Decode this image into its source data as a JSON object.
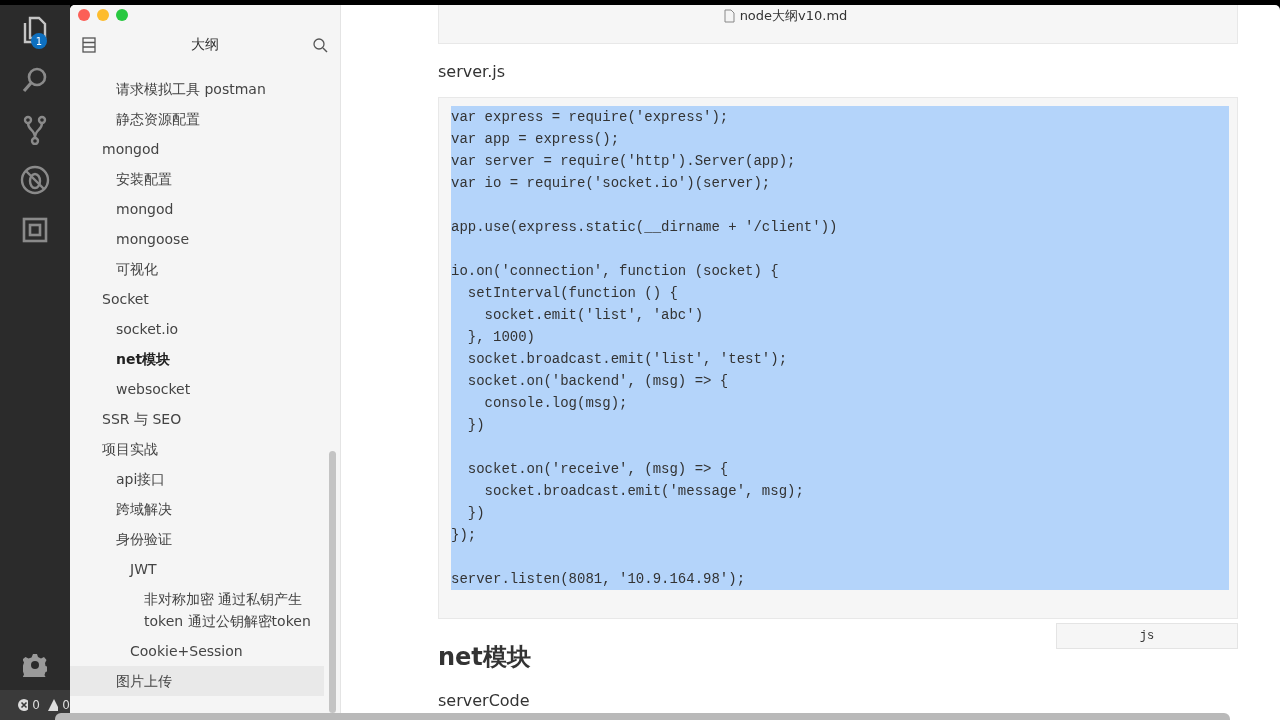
{
  "activity_bar": {
    "items": [
      {
        "kind": "files",
        "badge": "1"
      },
      {
        "kind": "search"
      },
      {
        "kind": "git"
      },
      {
        "kind": "debug"
      },
      {
        "kind": "extensions"
      }
    ],
    "status": {
      "errors": "0",
      "warnings": "0"
    }
  },
  "window": {
    "title": "node大纲v10.md"
  },
  "sidebar": {
    "title": "大纲",
    "items": [
      {
        "children": [
          {
            "label": "请求模拟工具 postman",
            "selected": false,
            "hovered": false
          },
          {
            "label": "静态资源配置",
            "selected": false,
            "hovered": false
          }
        ]
      },
      {
        "label": "mongod",
        "selected": false,
        "hovered": false,
        "children": [
          {
            "label": "安装配置",
            "selected": false,
            "hovered": false
          },
          {
            "label": "mongod",
            "selected": false,
            "hovered": false
          },
          {
            "label": "mongoose",
            "selected": false,
            "hovered": false
          },
          {
            "label": "可视化",
            "selected": false,
            "hovered": false
          }
        ]
      },
      {
        "label": "Socket",
        "selected": false,
        "hovered": false,
        "children": [
          {
            "label": "socket.io",
            "selected": false,
            "hovered": false
          },
          {
            "label": "net模块",
            "selected": true,
            "hovered": false
          },
          {
            "label": "websocket",
            "selected": false,
            "hovered": false
          }
        ]
      },
      {
        "label": "SSR 与 SEO",
        "selected": false,
        "hovered": false
      },
      {
        "label": "项目实战",
        "selected": false,
        "hovered": false,
        "children": [
          {
            "label": "api接口",
            "selected": false,
            "hovered": false
          },
          {
            "label": "跨域解决",
            "selected": false,
            "hovered": false
          },
          {
            "label": "身份验证",
            "selected": false,
            "hovered": false,
            "children": [
              {
                "label": "JWT",
                "selected": false,
                "hovered": false,
                "children": [
                  {
                    "label": "非对称加密 通过私钥产生token 通过公钥解密token",
                    "selected": false,
                    "hovered": false
                  }
                ]
              },
              {
                "label": "Cookie+Session",
                "selected": false,
                "hovered": false
              }
            ]
          },
          {
            "label": "图片上传",
            "selected": false,
            "hovered": true
          }
        ]
      }
    ]
  },
  "document": {
    "blocks": [
      {
        "kind": "code_end"
      },
      {
        "kind": "paragraph",
        "text": "server.js"
      },
      {
        "kind": "code",
        "selected": true,
        "language": "js",
        "code": "var express = require('express');\nvar app = express();\nvar server = require('http').Server(app);\nvar io = require('socket.io')(server);\n\napp.use(express.static(__dirname + '/client'))\n\nio.on('connection', function (socket) {\n  setInterval(function () {\n    socket.emit('list', 'abc')\n  }, 1000)\n  socket.broadcast.emit('list', 'test');\n  socket.on('backend', (msg) => {\n    console.log(msg);\n  })\n\n  socket.on('receive', (msg) => {\n    socket.broadcast.emit('message', msg);\n  })\n});\n\nserver.listen(8081, '10.9.164.98');"
      },
      {
        "kind": "heading",
        "text": "net模块"
      },
      {
        "kind": "paragraph",
        "text": "serverCode"
      }
    ]
  }
}
